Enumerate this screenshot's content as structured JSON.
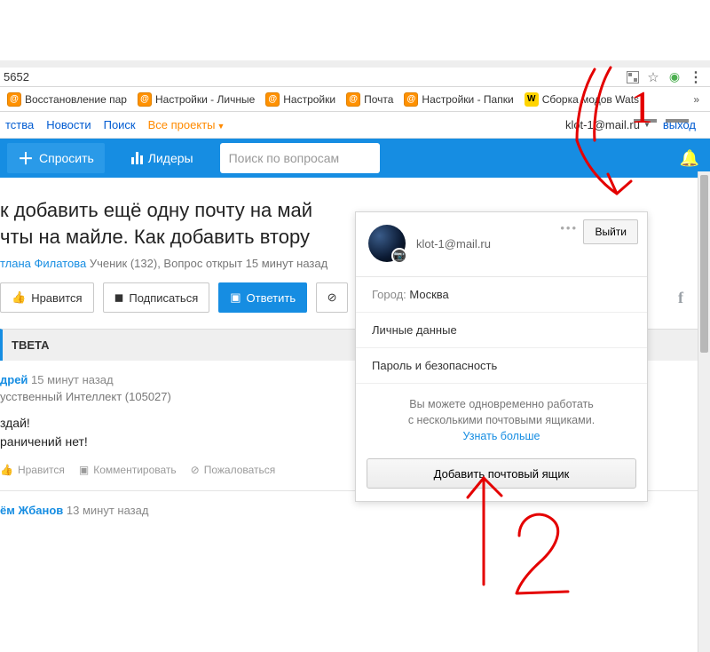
{
  "browser": {
    "url_fragment": "5652",
    "bookmarks": [
      {
        "label": "Восстановление пар",
        "icon": "orange"
      },
      {
        "label": "Настройки - Личные",
        "icon": "orange"
      },
      {
        "label": "Настройки",
        "icon": "orange"
      },
      {
        "label": "Почта",
        "icon": "orange"
      },
      {
        "label": "Настройки - Папки",
        "icon": "orange"
      },
      {
        "label": "Сборка модов Wats",
        "icon": "yellow",
        "badge": "W"
      }
    ]
  },
  "top_nav": {
    "left": [
      {
        "label": "тства"
      },
      {
        "label": "Новости"
      },
      {
        "label": "Поиск"
      },
      {
        "label": "Все проекты",
        "orange": true,
        "caret": true
      }
    ],
    "user_email": "klot-1@mail.ru",
    "logout": "выход"
  },
  "blue_bar": {
    "ask": "Спросить",
    "leaders": "Лидеры",
    "search_placeholder": "Поиск по вопросам"
  },
  "question": {
    "title_line1": "к добавить ещё одну почту на май",
    "title_line2": "чты на майле. Как добавить втору",
    "author": "тлана Филатова",
    "rank_open": "Ученик (132), Вопрос открыт 15 минут назад",
    "like": "Нравится",
    "subscribe": "Подписаться",
    "answer": "Ответить"
  },
  "answers_header": "ТВЕТА",
  "answer1": {
    "author": "дрей",
    "time": "15 минут назад",
    "rank": "усственный Интеллект (105027)",
    "line1": "здай!",
    "line2": "раничений нет!",
    "like": "Нравится",
    "comment": "Комментировать",
    "report": "Пожаловаться"
  },
  "answer2": {
    "author": "ём Жбанов",
    "time": "13 минут назад"
  },
  "dropdown": {
    "email": "klot-1@mail.ru",
    "logout": "Выйти",
    "city_label": "Город:",
    "city_value": "Москва",
    "personal": "Личные данные",
    "security": "Пароль и безопасность",
    "info_line1": "Вы можете одновременно работать",
    "info_line2": "с несколькими почтовыми ящиками.",
    "learn_more": "Узнать больше",
    "add_mailbox": "Добавить почтовый ящик"
  },
  "annotations": {
    "one": "1",
    "two": "2"
  }
}
